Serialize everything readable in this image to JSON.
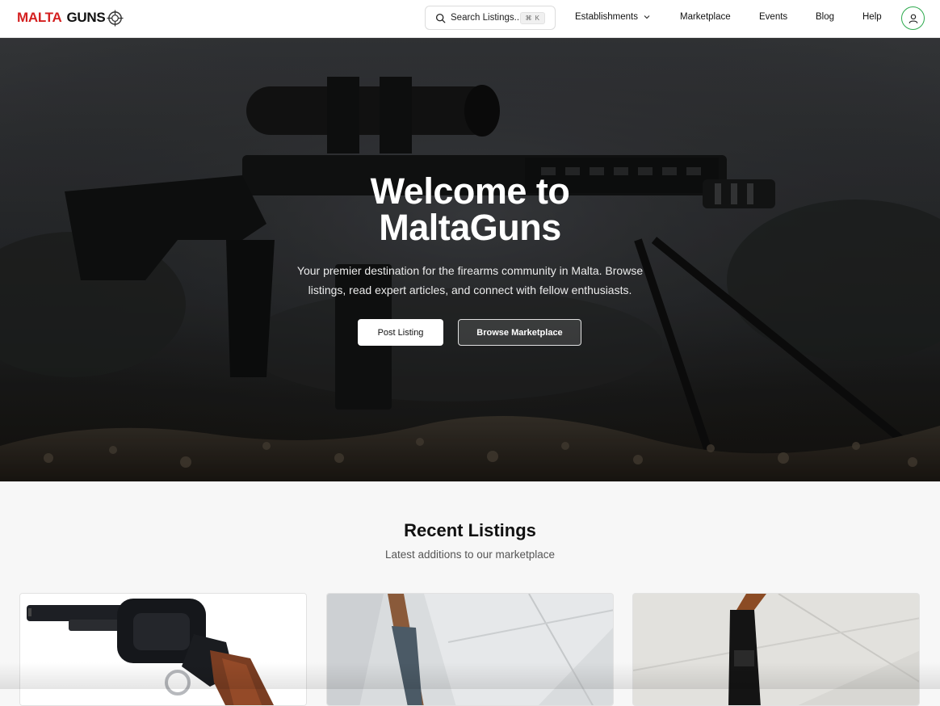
{
  "header": {
    "logo_part1": "MALTA",
    "logo_part2": "GUNS",
    "search_label": "Search Listings...",
    "search_shortcut": "⌘ K",
    "nav": {
      "establishments": "Establishments",
      "marketplace": "Marketplace",
      "events": "Events",
      "blog": "Blog",
      "help": "Help"
    }
  },
  "hero": {
    "title_line1": "Welcome to",
    "title_line2": "MaltaGuns",
    "subtitle": "Your premier destination for the firearms community in Malta. Browse listings, read expert articles, and connect with fellow enthusiasts.",
    "post_button": "Post Listing",
    "browse_button": "Browse Marketplace"
  },
  "recent": {
    "title": "Recent Listings",
    "subtitle": "Latest additions to our marketplace"
  },
  "colors": {
    "brand_red": "#d42020",
    "avatar_ring": "#2eaa4e",
    "hero_dark": "#26282a"
  }
}
